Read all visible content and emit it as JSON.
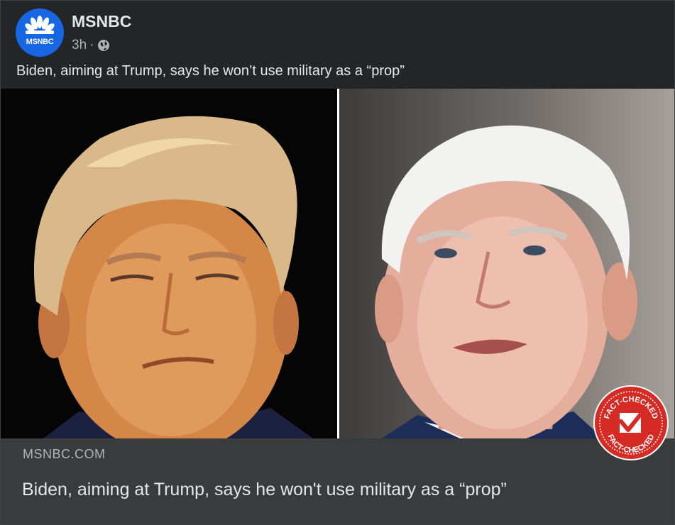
{
  "post": {
    "page_name": "MSNBC",
    "avatar_label": "MSNBC",
    "time": "3h",
    "separator": "·",
    "audience_icon": "globe-icon",
    "caption": "Biden, aiming at Trump, says he won’t use military as a “prop”"
  },
  "link_preview": {
    "domain": "MSNBC.COM",
    "headline": "Biden, aiming at Trump, says he won't use military as a “prop”"
  },
  "badge": {
    "text_top": "FACT-CHECKED",
    "text_bottom": "FACT-CHECKED",
    "icon": "checkmark-icon",
    "color": "#d62b24"
  },
  "colors": {
    "card_bg": "#242526",
    "link_bg": "#3a3b3c",
    "brand": "#1767e5"
  }
}
